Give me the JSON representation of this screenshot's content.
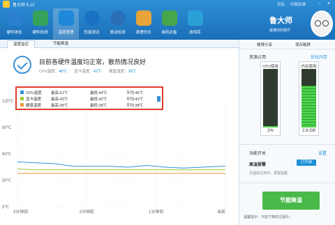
{
  "app": {
    "title": "鲁大师 5.12",
    "top_links": [
      "论坛",
      "问题反馈"
    ],
    "window_controls": [
      "-",
      "×"
    ],
    "brand_name": "鲁大师",
    "brand_slogan": "最懂你的硬件"
  },
  "nav": {
    "items": [
      {
        "label": "硬件体检",
        "icon": "monitor-icon",
        "color": "#2b7fd0"
      },
      {
        "label": "硬件检测",
        "icon": "chip-icon",
        "color": "#35a35a"
      },
      {
        "label": "温度管理",
        "icon": "thermometer-chart-icon",
        "color": "#1f88d9",
        "active": true
      },
      {
        "label": "性能测试",
        "icon": "speedometer-icon",
        "color": "#1b72c5"
      },
      {
        "label": "驱动检测",
        "icon": "gear-icon",
        "color": "#2a6fb8"
      },
      {
        "label": "清理优化",
        "icon": "broom-icon",
        "color": "#e8a33a"
      },
      {
        "label": "装机必备",
        "icon": "box-icon",
        "color": "#47a54c"
      },
      {
        "label": "游戏库",
        "icon": "gamepad-icon",
        "color": "#2ba0d8"
      }
    ]
  },
  "tabs": [
    "温度监控",
    "节能降温"
  ],
  "status": {
    "title": "目前各硬件温度均正常，散热情况良好",
    "cpu_label": "CPU温度：",
    "cpu_value": "48℃",
    "gpu_label": "显卡温度：",
    "gpu_value": "42℃",
    "disk_label": "硬盘温度：",
    "disk_value": "38℃"
  },
  "legend": [
    {
      "name": "CPU温度",
      "max": "最高:51℃",
      "min": "最低:44℃",
      "avg": "平均:46℃",
      "color": "#2f8fd6"
    },
    {
      "name": "显卡温度",
      "max": "最高:43℃",
      "min": "最低:42℃",
      "avg": "平均:42℃",
      "color": "#a0c534"
    },
    {
      "name": "硬盘温度",
      "max": "最高:38℃",
      "min": "最低:38℃",
      "avg": "平均:38℃",
      "color": "#e89a3a"
    }
  ],
  "chart_data": {
    "type": "line",
    "xlabel": "",
    "ylabel": "",
    "x_ticks": [
      "3分钟前",
      "2分钟前",
      "1分钟前",
      "当前"
    ],
    "y_ticks": [
      "120℃",
      "90℃",
      "60℃",
      "30℃",
      "0℃"
    ],
    "ylim": [
      0,
      120
    ],
    "x": [
      0,
      16,
      32,
      48,
      64,
      80,
      96,
      112,
      128,
      144,
      160,
      176,
      180
    ],
    "series": [
      {
        "name": "CPU温度",
        "color": "#2f8fd6",
        "values": [
          51,
          50,
          49,
          46,
          46,
          46,
          45,
          47,
          45,
          44,
          45,
          46,
          46
        ]
      },
      {
        "name": "显卡温度",
        "color": "#a0c534",
        "values": [
          43,
          42,
          42,
          42,
          42,
          42,
          42,
          42,
          42,
          42,
          42,
          42,
          42
        ]
      },
      {
        "name": "硬盘温度",
        "color": "#e89a3a",
        "values": [
          38,
          38,
          38,
          38,
          38,
          38,
          38,
          38,
          38,
          38,
          38,
          38,
          38
        ]
      }
    ]
  },
  "right": {
    "share": "微博分享",
    "save": "保存截屏",
    "resource_title": "资源占用",
    "optimize": "优化内存",
    "cpu_label": "CPU使用",
    "cpu_value": "2%",
    "cpu_fraction": 0.02,
    "mem_label": "内存使用",
    "mem_value": "2.8 GB",
    "mem_fraction": 0.72,
    "func_title": "功能开关",
    "settings": "设置",
    "alarm_label": "高温报警",
    "alarm_toggle": "已开启",
    "alarm_desc": "当温度过高时，报警提醒",
    "boost_button": "节能降温",
    "boost_desc": "温馨提示：不能下降的过程中，"
  }
}
